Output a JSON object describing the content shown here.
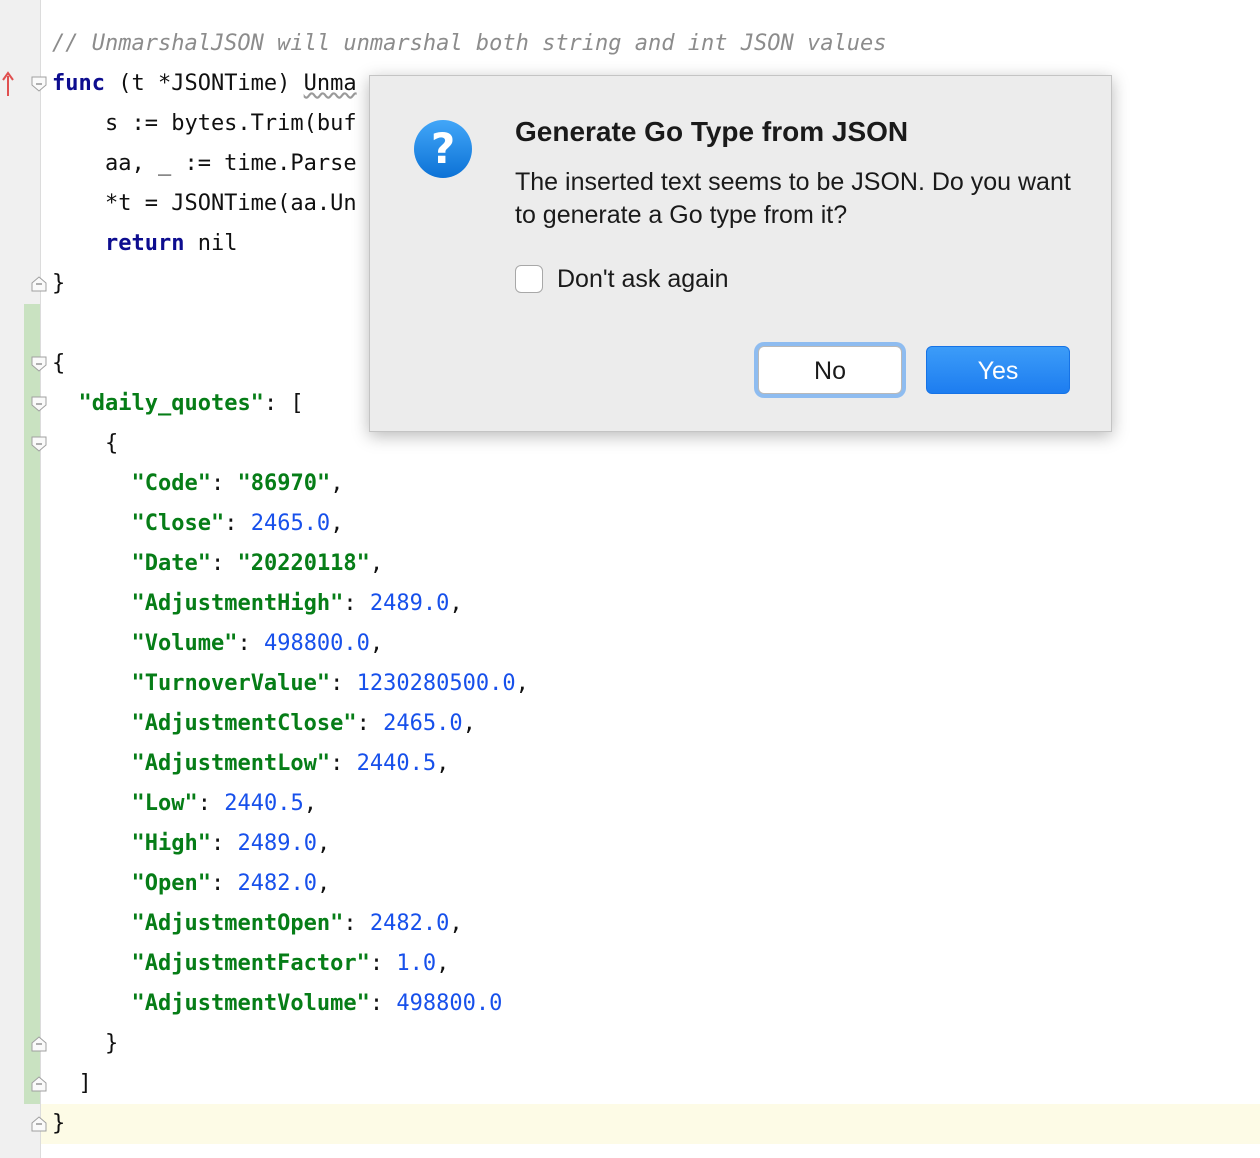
{
  "editor": {
    "lines": [
      [
        {
          "t": "// UnmarshalJSON will unmarshal both string and int JSON values",
          "c": "cmt"
        }
      ],
      [
        {
          "t": "func",
          "c": "kw"
        },
        {
          "t": " (t *JSONTime) "
        },
        {
          "t": "Unma",
          "c": "squig"
        }
      ],
      [
        {
          "t": "    s := bytes.Trim(buf"
        }
      ],
      [
        {
          "t": "    aa, _ := time.Parse"
        }
      ],
      [
        {
          "t": "    *t = JSONTime(aa.Un"
        }
      ],
      [
        {
          "t": "    "
        },
        {
          "t": "return",
          "c": "kw"
        },
        {
          "t": " nil"
        }
      ],
      [
        {
          "t": "}"
        }
      ],
      [
        {
          "t": ""
        }
      ],
      [
        {
          "t": "{"
        }
      ],
      [
        {
          "t": "  "
        },
        {
          "t": "\"daily_quotes\"",
          "c": "key"
        },
        {
          "t": ": ["
        }
      ],
      [
        {
          "t": "    {"
        }
      ],
      [
        {
          "t": "      "
        },
        {
          "t": "\"Code\"",
          "c": "key"
        },
        {
          "t": ": "
        },
        {
          "t": "\"86970\"",
          "c": "str"
        },
        {
          "t": ","
        }
      ],
      [
        {
          "t": "      "
        },
        {
          "t": "\"Close\"",
          "c": "key"
        },
        {
          "t": ": "
        },
        {
          "t": "2465.0",
          "c": "num"
        },
        {
          "t": ","
        }
      ],
      [
        {
          "t": "      "
        },
        {
          "t": "\"Date\"",
          "c": "key"
        },
        {
          "t": ": "
        },
        {
          "t": "\"20220118\"",
          "c": "str"
        },
        {
          "t": ","
        }
      ],
      [
        {
          "t": "      "
        },
        {
          "t": "\"AdjustmentHigh\"",
          "c": "key"
        },
        {
          "t": ": "
        },
        {
          "t": "2489.0",
          "c": "num"
        },
        {
          "t": ","
        }
      ],
      [
        {
          "t": "      "
        },
        {
          "t": "\"Volume\"",
          "c": "key"
        },
        {
          "t": ": "
        },
        {
          "t": "498800.0",
          "c": "num"
        },
        {
          "t": ","
        }
      ],
      [
        {
          "t": "      "
        },
        {
          "t": "\"TurnoverValue\"",
          "c": "key"
        },
        {
          "t": ": "
        },
        {
          "t": "1230280500.0",
          "c": "num"
        },
        {
          "t": ","
        }
      ],
      [
        {
          "t": "      "
        },
        {
          "t": "\"AdjustmentClose\"",
          "c": "key"
        },
        {
          "t": ": "
        },
        {
          "t": "2465.0",
          "c": "num"
        },
        {
          "t": ","
        }
      ],
      [
        {
          "t": "      "
        },
        {
          "t": "\"AdjustmentLow\"",
          "c": "key"
        },
        {
          "t": ": "
        },
        {
          "t": "2440.5",
          "c": "num"
        },
        {
          "t": ","
        }
      ],
      [
        {
          "t": "      "
        },
        {
          "t": "\"Low\"",
          "c": "key"
        },
        {
          "t": ": "
        },
        {
          "t": "2440.5",
          "c": "num"
        },
        {
          "t": ","
        }
      ],
      [
        {
          "t": "      "
        },
        {
          "t": "\"High\"",
          "c": "key"
        },
        {
          "t": ": "
        },
        {
          "t": "2489.0",
          "c": "num"
        },
        {
          "t": ","
        }
      ],
      [
        {
          "t": "      "
        },
        {
          "t": "\"Open\"",
          "c": "key"
        },
        {
          "t": ": "
        },
        {
          "t": "2482.0",
          "c": "num"
        },
        {
          "t": ","
        }
      ],
      [
        {
          "t": "      "
        },
        {
          "t": "\"AdjustmentOpen\"",
          "c": "key"
        },
        {
          "t": ": "
        },
        {
          "t": "2482.0",
          "c": "num"
        },
        {
          "t": ","
        }
      ],
      [
        {
          "t": "      "
        },
        {
          "t": "\"AdjustmentFactor\"",
          "c": "key"
        },
        {
          "t": ": "
        },
        {
          "t": "1.0",
          "c": "num"
        },
        {
          "t": ","
        }
      ],
      [
        {
          "t": "      "
        },
        {
          "t": "\"AdjustmentVolume\"",
          "c": "key"
        },
        {
          "t": ": "
        },
        {
          "t": "498800.0",
          "c": "num"
        }
      ],
      [
        {
          "t": "    }"
        }
      ],
      [
        {
          "t": "  ]"
        }
      ],
      [
        {
          "t": "}"
        }
      ]
    ],
    "fold_markers": [
      {
        "line": 1,
        "kind": "open"
      },
      {
        "line": 6,
        "kind": "close"
      },
      {
        "line": 8,
        "kind": "open"
      },
      {
        "line": 9,
        "kind": "open"
      },
      {
        "line": 10,
        "kind": "open"
      },
      {
        "line": 25,
        "kind": "close"
      },
      {
        "line": 26,
        "kind": "close"
      },
      {
        "line": 27,
        "kind": "close"
      }
    ],
    "gutter_icon": "implements-up-arrow-icon"
  },
  "dialog": {
    "icon": "question-icon",
    "icon_glyph": "?",
    "title": "Generate Go Type from JSON",
    "message": "The inserted text seems to be JSON. Do you want to generate a Go type from it?",
    "checkbox_label": "Don't ask again",
    "checkbox_checked": false,
    "no_label": "No",
    "yes_label": "Yes"
  },
  "colors": {
    "keyword": "#0d0d8f",
    "json_key": "#067d17",
    "number": "#1750eb",
    "comment": "#8c8c8c",
    "primary_button": "#1d7df0",
    "focus_ring": "#8ebcf0"
  }
}
